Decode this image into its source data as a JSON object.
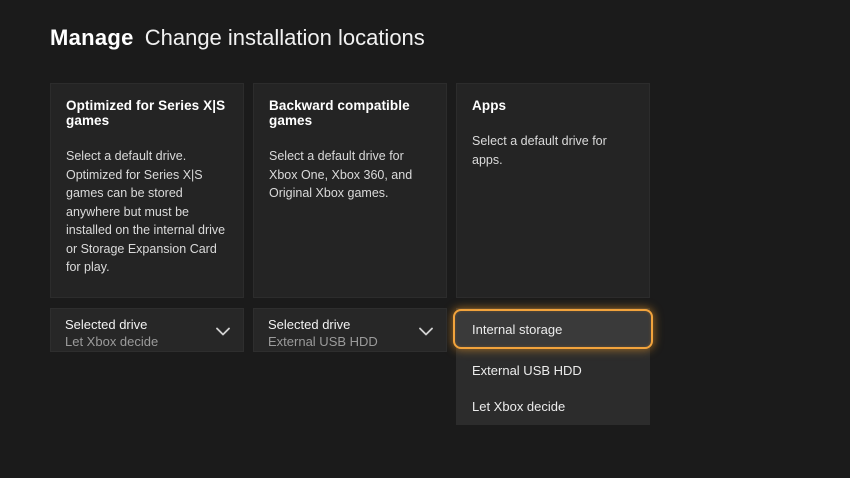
{
  "header": {
    "title_primary": "Manage",
    "title_secondary": "Change installation locations"
  },
  "colors": {
    "page_background": "#1b1b1b",
    "card_background": "#242424",
    "select_bar_background": "#272727",
    "listbox_background": "#2c2c2c",
    "active_option_background": "#3a3a3a",
    "focus_accent": "#f2a33c",
    "heading_text": "#ffffff",
    "body_text": "#dadada",
    "muted_value_text": "#9b9b9b"
  },
  "icons": {
    "select_expander": "chevron-down"
  },
  "cards": [
    {
      "heading": "Optimized for Series X|S games",
      "description": "Select a default drive. Optimized for Series X|S games can be stored anywhere but must be installed on the internal drive or Storage Expansion Card for play.",
      "select": {
        "label": "Selected drive",
        "value": "Let Xbox decide"
      }
    },
    {
      "heading": "Backward compatible games",
      "description": "Select a default drive for Xbox One, Xbox 360, and Original Xbox games.",
      "select": {
        "label": "Selected drive",
        "value": "External USB HDD"
      }
    },
    {
      "heading": "Apps",
      "description": "Select a default drive for apps.",
      "dropdown": {
        "options": [
          "Internal storage",
          "External USB HDD",
          "Let Xbox decide"
        ],
        "active_option": "Internal storage"
      }
    }
  ]
}
